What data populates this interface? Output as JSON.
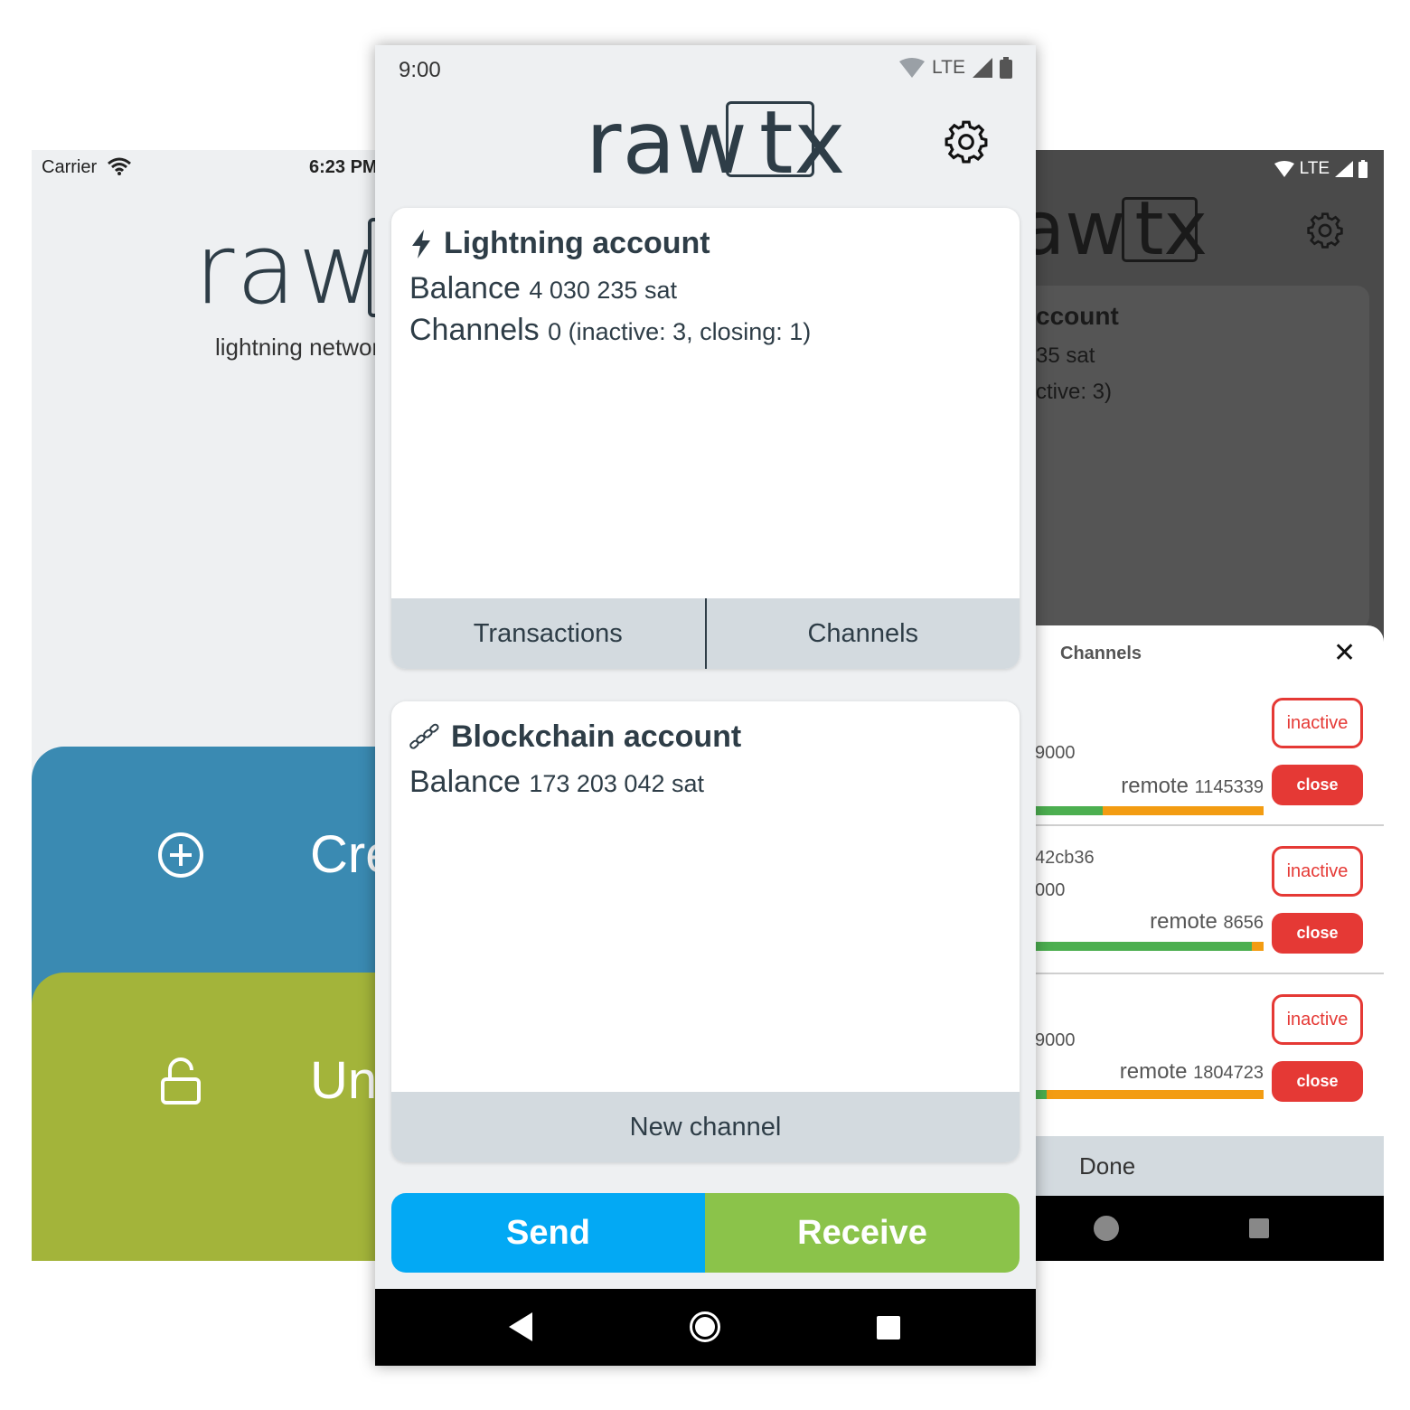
{
  "left_phone": {
    "status": {
      "carrier": "Carrier",
      "time": "6:23 PM"
    },
    "logo_text": "raw",
    "tagline": "lightning network",
    "create_label": "Create",
    "unlock_label": "Unlock",
    "create_color": "#3a8ab2",
    "unlock_color": "#a3b43a"
  },
  "center_phone": {
    "status": {
      "time": "9:00",
      "network": "LTE"
    },
    "logo": {
      "left": "raw",
      "boxed": "tx"
    },
    "lightning": {
      "title": "Lightning account",
      "balance_label": "Balance",
      "balance_value": "4 030 235 sat",
      "channels_label": "Channels",
      "channels_value": "0 (inactive: 3, closing: 1)",
      "tab_transactions": "Transactions",
      "tab_channels": "Channels"
    },
    "blockchain": {
      "title": "Blockchain account",
      "balance_label": "Balance",
      "balance_value": "173 203 042 sat",
      "new_channel": "New channel"
    },
    "send_label": "Send",
    "receive_label": "Receive",
    "send_color": "#03a9f4",
    "receive_color": "#8bc34a"
  },
  "right_phone": {
    "status": {
      "network": "LTE"
    },
    "logo": {
      "left": "aw",
      "boxed": "tx"
    },
    "card": {
      "title": "ccount",
      "line1": "35 sat",
      "line2": "ctive: 3)"
    },
    "sheet": {
      "title": "Channels",
      "done_label": "Done",
      "channels": [
        {
          "id_line1": "",
          "id_line2": "9000",
          "remote_label": "remote",
          "remote_value": "1145339",
          "local_fraction": 0.31,
          "inactive_label": "inactive",
          "close_label": "close"
        },
        {
          "id_line1": "42cb36",
          "id_line2": "000",
          "remote_label": "remote",
          "remote_value": "8656",
          "local_fraction": 0.95,
          "inactive_label": "inactive",
          "close_label": "close"
        },
        {
          "id_line1": "",
          "id_line2": "9000",
          "remote_label": "remote",
          "remote_value": "1804723",
          "local_fraction": 0.07,
          "inactive_label": "inactive",
          "close_label": "close"
        }
      ]
    }
  }
}
